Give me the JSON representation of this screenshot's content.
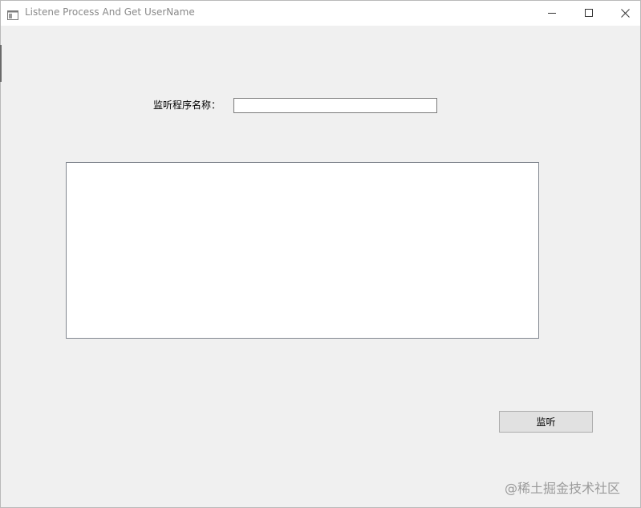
{
  "window": {
    "title": "Listene Process And Get UserName",
    "icons": {
      "app": "app-window-icon",
      "minimize": "minimize-icon",
      "maximize": "maximize-icon",
      "close": "close-icon"
    }
  },
  "form": {
    "process_name_label": "监听程序名称：",
    "process_name_value": "",
    "output_value": "",
    "listen_button_label": "监听"
  },
  "watermark": {
    "text": "@稀土掘金技术社区"
  }
}
